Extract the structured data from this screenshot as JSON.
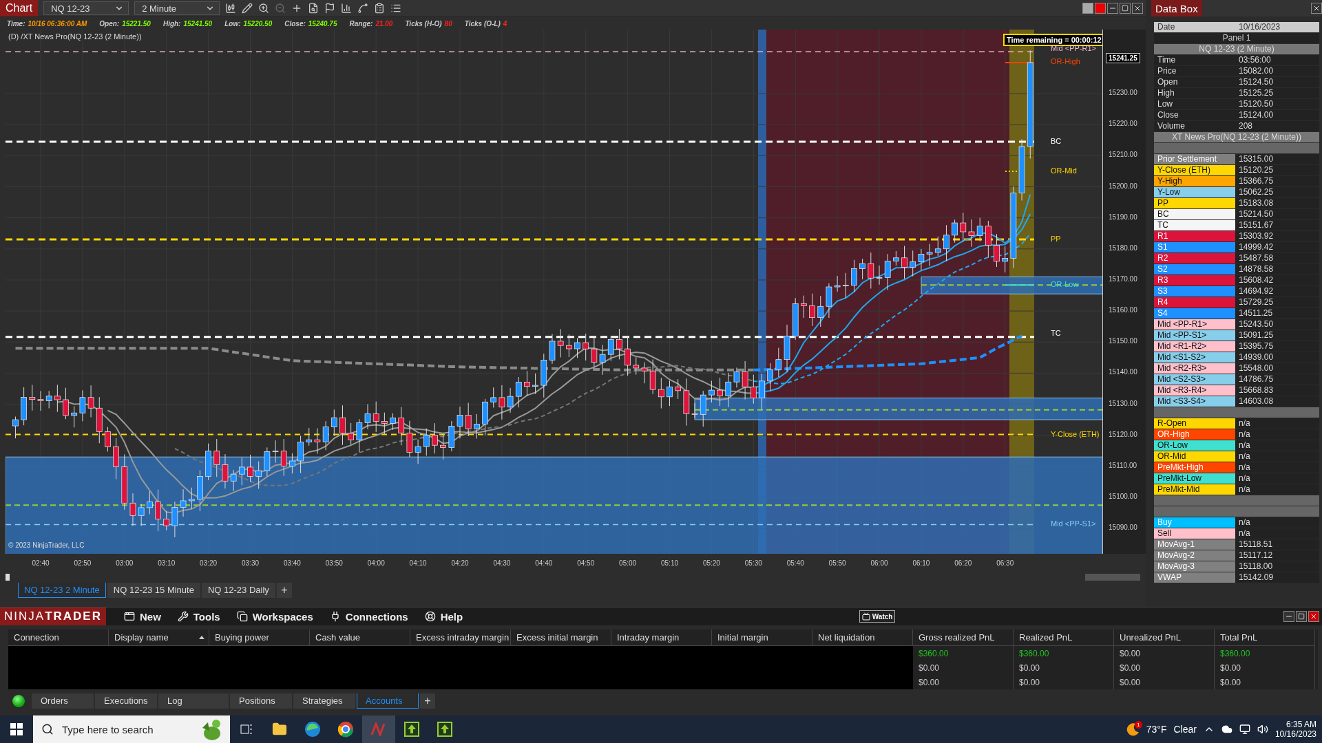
{
  "chart_window": {
    "title": "Chart",
    "instrument": "NQ 12-23",
    "interval": "2 Minute"
  },
  "info_fields": [
    {
      "label": "Time:",
      "value": "10/16 06:36:00 AM",
      "color": "#ff9900"
    },
    {
      "label": "Open:",
      "value": "15221.50",
      "color": "#7fff00"
    },
    {
      "label": "High:",
      "value": "15241.50",
      "color": "#7fff00"
    },
    {
      "label": "Low:",
      "value": "15220.50",
      "color": "#7fff00"
    },
    {
      "label": "Close:",
      "value": "15240.75",
      "color": "#7fff00"
    },
    {
      "label": "Range:",
      "value": "21.00",
      "color": "#ff2020"
    },
    {
      "label": "Ticks (H-O)",
      "value": "80",
      "color": "#ff2020"
    },
    {
      "label": "Ticks (O-L)",
      "value": "4",
      "color": "#ff2020"
    }
  ],
  "indicator_label": "(D) /XT News Pro(NQ 12-23 (2 Minute))",
  "timer": "Time remaining = 00:00:12",
  "copyright": "© 2023 NinjaTrader, LLC",
  "levels": [
    {
      "label": "Mid <PP-R1>",
      "color": "#f4b6c2"
    },
    {
      "label": "OR-High",
      "color": "#ff4500"
    },
    {
      "label": "BC",
      "color": "#ffffff"
    },
    {
      "label": "OR-Mid",
      "color": "#ffd700"
    },
    {
      "label": "PP",
      "color": "#ffd700"
    },
    {
      "label": "OR-Low",
      "color": "#40e0d0"
    },
    {
      "label": "TC",
      "color": "#ffffff"
    },
    {
      "label": "Y-Close (ETH)",
      "color": "#ffd700"
    },
    {
      "label": "Mid <PP-S1>",
      "color": "#87ceeb"
    }
  ],
  "price_ticks": [
    "15230.00",
    "15220.00",
    "15210.00",
    "15200.00",
    "15190.00",
    "15180.00",
    "15170.00",
    "15160.00",
    "15150.00",
    "15140.00",
    "15130.00",
    "15120.00",
    "15110.00",
    "15100.00",
    "15090.00"
  ],
  "current_price": "15241.25",
  "time_ticks": [
    "02:40",
    "02:50",
    "03:00",
    "03:10",
    "03:20",
    "03:30",
    "03:40",
    "03:50",
    "04:00",
    "04:10",
    "04:20",
    "04:30",
    "04:40",
    "04:50",
    "05:00",
    "05:10",
    "05:20",
    "05:30",
    "05:40",
    "05:50",
    "06:00",
    "06:10",
    "06:20",
    "06:30"
  ],
  "chart_tabs": [
    {
      "label": "NQ 12-23 2 Minute",
      "selected": true
    },
    {
      "label": "NQ 12-23 15 Minute",
      "selected": false
    },
    {
      "label": "NQ 12-23 Daily",
      "selected": false
    }
  ],
  "add_chart_tab": "+",
  "data_box": {
    "title": "Data Box",
    "date_label": "Date",
    "date_value": "10/16/2023",
    "panel": "Panel 1",
    "series_title": "NQ 12-23 (2 Minute)",
    "series_rows": [
      {
        "label": "Time",
        "value": "03:56:00"
      },
      {
        "label": "Price",
        "value": "15082.00"
      },
      {
        "label": "Open",
        "value": "15124.50"
      },
      {
        "label": "High",
        "value": "15125.25"
      },
      {
        "label": "Low",
        "value": "15120.50"
      },
      {
        "label": "Close",
        "value": "15124.00"
      },
      {
        "label": "Volume",
        "value": "208"
      }
    ],
    "indicator_title": "XT News Pro(NQ 12-23 (2 Minute))",
    "items": [
      {
        "kind": "blank"
      },
      {
        "kind": "row",
        "label": "Prior Settlement",
        "value": "15315.00",
        "color": "#808080"
      },
      {
        "kind": "row",
        "label": "Y-Close (ETH)",
        "value": "15120.25",
        "color": "#ffd700"
      },
      {
        "kind": "row",
        "label": "Y-High",
        "value": "15366.75",
        "color": "#ffa500"
      },
      {
        "kind": "row",
        "label": "Y-Low",
        "value": "15062.25",
        "color": "#87ceeb"
      },
      {
        "kind": "row",
        "label": "PP",
        "value": "15183.08",
        "color": "#ffd700"
      },
      {
        "kind": "row",
        "label": "BC",
        "value": "15214.50",
        "color": "#f5f5f5"
      },
      {
        "kind": "row",
        "label": "TC",
        "value": "15151.67",
        "color": "#f5f5f5"
      },
      {
        "kind": "row",
        "label": "R1",
        "value": "15303.92",
        "color": "#dc143c"
      },
      {
        "kind": "row",
        "label": "S1",
        "value": "14999.42",
        "color": "#1e90ff"
      },
      {
        "kind": "row",
        "label": "R2",
        "value": "15487.58",
        "color": "#dc143c"
      },
      {
        "kind": "row",
        "label": "S2",
        "value": "14878.58",
        "color": "#1e90ff"
      },
      {
        "kind": "row",
        "label": "R3",
        "value": "15608.42",
        "color": "#dc143c"
      },
      {
        "kind": "row",
        "label": "S3",
        "value": "14694.92",
        "color": "#1e90ff"
      },
      {
        "kind": "row",
        "label": "R4",
        "value": "15729.25",
        "color": "#dc143c"
      },
      {
        "kind": "row",
        "label": "S4",
        "value": "14511.25",
        "color": "#1e90ff"
      },
      {
        "kind": "row",
        "label": "Mid <PP-R1>",
        "value": "15243.50",
        "color": "#ffc0cb"
      },
      {
        "kind": "row",
        "label": "Mid <PP-S1>",
        "value": "15091.25",
        "color": "#87ceeb"
      },
      {
        "kind": "row",
        "label": "Mid <R1-R2>",
        "value": "15395.75",
        "color": "#ffc0cb"
      },
      {
        "kind": "row",
        "label": "Mid <S1-S2>",
        "value": "14939.00",
        "color": "#87ceeb"
      },
      {
        "kind": "row",
        "label": "Mid <R2-R3>",
        "value": "15548.00",
        "color": "#ffc0cb"
      },
      {
        "kind": "row",
        "label": "Mid <S2-S3>",
        "value": "14786.75",
        "color": "#87ceeb"
      },
      {
        "kind": "row",
        "label": "Mid <R3-R4>",
        "value": "15668.83",
        "color": "#ffc0cb"
      },
      {
        "kind": "row",
        "label": "Mid <S3-S4>",
        "value": "14603.08",
        "color": "#87ceeb"
      },
      {
        "kind": "blank"
      },
      {
        "kind": "row",
        "label": "R-Open",
        "value": "n/a",
        "color": "#ffd700"
      },
      {
        "kind": "row",
        "label": "OR-High",
        "value": "n/a",
        "color": "#ff4500"
      },
      {
        "kind": "row",
        "label": "OR-Low",
        "value": "n/a",
        "color": "#40e0d0"
      },
      {
        "kind": "row",
        "label": "OR-Mid",
        "value": "n/a",
        "color": "#ffd700"
      },
      {
        "kind": "row",
        "label": "PreMkt-High",
        "value": "n/a",
        "color": "#ff4500"
      },
      {
        "kind": "row",
        "label": "PreMkt-Low",
        "value": "n/a",
        "color": "#40e0d0"
      },
      {
        "kind": "row",
        "label": "PreMkt-Mid",
        "value": "n/a",
        "color": "#ffd700"
      },
      {
        "kind": "blank"
      },
      {
        "kind": "blank"
      },
      {
        "kind": "row",
        "label": "Buy",
        "value": "n/a",
        "color": "#00bfff"
      },
      {
        "kind": "row",
        "label": "Sell",
        "value": "n/a",
        "color": "#ffc0cb"
      },
      {
        "kind": "row",
        "label": "MovAvg-1",
        "value": "15118.51",
        "color": "#808080"
      },
      {
        "kind": "row",
        "label": "MovAvg-2",
        "value": "15117.12",
        "color": "#808080"
      },
      {
        "kind": "row",
        "label": "MovAvg-3",
        "value": "15118.00",
        "color": "#808080"
      },
      {
        "kind": "row",
        "label": "VWAP",
        "value": "15142.09",
        "color": "#808080"
      }
    ]
  },
  "menu": {
    "brand": "NINJA**TRADER**",
    "items": [
      "New",
      "Tools",
      "Workspaces",
      "Connections",
      "Help"
    ],
    "watch": "Watch"
  },
  "accounts": {
    "columns": [
      {
        "label": "Connection",
        "sorted": false
      },
      {
        "label": "Display name",
        "sorted": true
      },
      {
        "label": "Buying power",
        "sorted": false
      },
      {
        "label": "Cash value",
        "sorted": false
      },
      {
        "label": "Excess intraday margin",
        "sorted": false
      },
      {
        "label": "Excess initial margin",
        "sorted": false
      },
      {
        "label": "Intraday margin",
        "sorted": false
      },
      {
        "label": "Initial margin",
        "sorted": false
      },
      {
        "label": "Net liquidation",
        "sorted": false
      },
      {
        "label": "Gross realized PnL",
        "sorted": false
      },
      {
        "label": "Realized PnL",
        "sorted": false
      },
      {
        "label": "Unrealized PnL",
        "sorted": false
      },
      {
        "label": "Total PnL",
        "sorted": false
      }
    ],
    "rows": [
      {
        "cells": [
          {
            "text": "$360.00",
            "color": "#22c322"
          },
          {
            "text": "$360.00",
            "color": "#22c322"
          },
          {
            "text": "$0.00",
            "color": "#d0d0d0"
          },
          {
            "text": "$360.00",
            "color": "#22c322"
          }
        ]
      },
      {
        "cells": [
          {
            "text": "$0.00",
            "color": "#d0d0d0"
          },
          {
            "text": "$0.00",
            "color": "#d0d0d0"
          },
          {
            "text": "$0.00",
            "color": "#d0d0d0"
          },
          {
            "text": "$0.00",
            "color": "#d0d0d0"
          }
        ]
      },
      {
        "cells": [
          {
            "text": "$0.00",
            "color": "#d0d0d0"
          },
          {
            "text": "$0.00",
            "color": "#d0d0d0"
          },
          {
            "text": "$0.00",
            "color": "#d0d0d0"
          },
          {
            "text": "$0.00",
            "color": "#d0d0d0"
          }
        ]
      }
    ]
  },
  "bottom_tabs": [
    {
      "label": "Orders",
      "selected": false
    },
    {
      "label": "Executions",
      "selected": false
    },
    {
      "label": "Log",
      "selected": false
    },
    {
      "label": "Positions",
      "selected": false
    },
    {
      "label": "Strategies",
      "selected": false
    },
    {
      "label": "Accounts",
      "selected": true
    }
  ],
  "add_tab": "+",
  "taskbar": {
    "search_placeholder": "Type here to search",
    "weather_badge": "1",
    "temperature": "73°F",
    "condition": "Clear",
    "time": "6:35 AM",
    "date": "10/16/2023"
  }
}
